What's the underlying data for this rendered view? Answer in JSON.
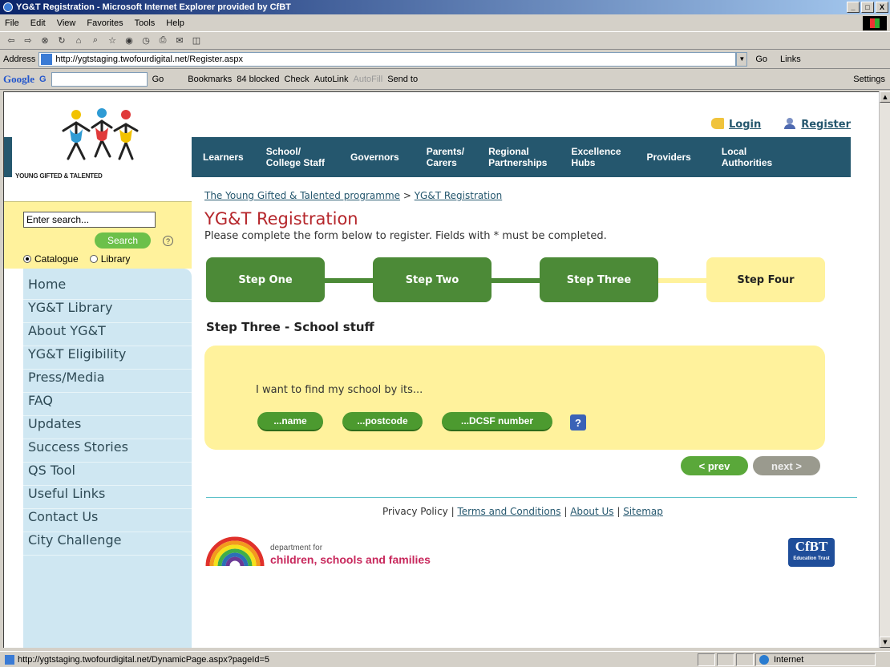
{
  "window": {
    "title": "YG&T Registration - Microsoft Internet Explorer provided by CfBT"
  },
  "menu": [
    "File",
    "Edit",
    "View",
    "Favorites",
    "Tools",
    "Help"
  ],
  "address": {
    "label": "Address",
    "url": "http://ygtstaging.twofourdigital.net/Register.aspx",
    "go": "Go",
    "links": "Links"
  },
  "googlebar": {
    "logo": "Google",
    "g": "G",
    "go": "Go",
    "bookmarks": "Bookmarks",
    "blocked": "84 blocked",
    "check": "Check",
    "autolink": "AutoLink",
    "autofill": "AutoFill",
    "sendto": "Send to",
    "settings": "Settings"
  },
  "status": {
    "url": "http://ygtstaging.twofourdigital.net/DynamicPage.aspx?pageId=5",
    "zone": "Internet"
  },
  "site": {
    "logo_text": "YOUNG GIFTED & TALENTED",
    "login": "Login",
    "register": "Register",
    "search_placeholder": "Enter search...",
    "search_button": "Search",
    "help": "?",
    "radio_catalogue": "Catalogue",
    "radio_library": "Library",
    "nav": [
      "Home",
      "YG&T Library",
      "About YG&T",
      "YG&T Eligibility",
      "Press/Media",
      "FAQ",
      "Updates",
      "Success Stories",
      "QS Tool",
      "Useful Links",
      "Contact Us",
      "City Challenge"
    ],
    "topnav": [
      {
        "line1": "Learners",
        "line2": ""
      },
      {
        "line1": "School/",
        "line2": "College Staff"
      },
      {
        "line1": "Governors",
        "line2": ""
      },
      {
        "line1": "Parents/",
        "line2": "Carers"
      },
      {
        "line1": "Regional",
        "line2": "Partnerships"
      },
      {
        "line1": "Excellence",
        "line2": "Hubs"
      },
      {
        "line1": "Providers",
        "line2": ""
      },
      {
        "line1": "Local",
        "line2": "Authorities"
      }
    ],
    "breadcrumb": {
      "home": "The Young Gifted & Talented programme",
      "sep": " > ",
      "current": "YG&T Registration"
    },
    "title": "YG&T Registration",
    "intro": "Please complete the form below to register. Fields with * must be completed.",
    "steps": [
      "Step One",
      "Step Two",
      "Step Three",
      "Step Four"
    ],
    "section_title": "Step Three - School stuff",
    "find_text": "I want to find my school by its...",
    "find_buttons": [
      "...name",
      "...postcode",
      "...DCSF number"
    ],
    "help_q": "?",
    "prev": "< prev",
    "next": "next >",
    "footer": {
      "privacy": "Privacy Policy",
      "sep": " | ",
      "terms": "Terms and Conditions",
      "about": "About Us",
      "sitemap": "Sitemap"
    },
    "dcsf_line1": "department for",
    "dcsf_line2": "children, schools and families",
    "cfbt": "CfBT",
    "cfbt_sub": "Education Trust"
  }
}
